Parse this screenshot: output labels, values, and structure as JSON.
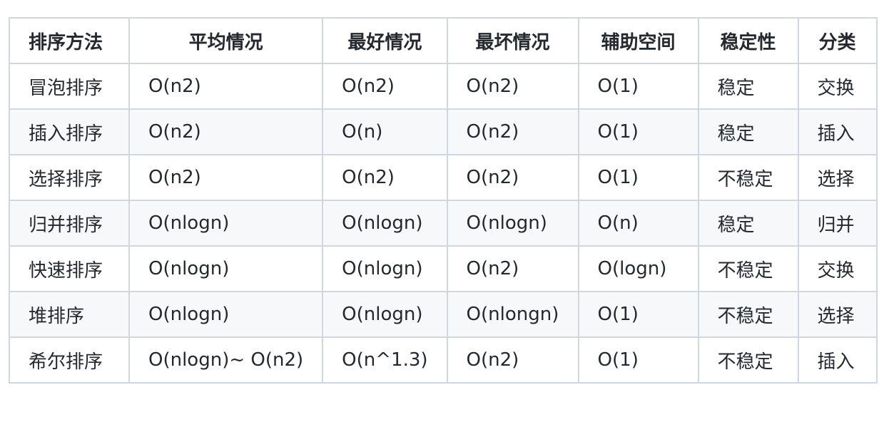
{
  "table": {
    "headers": [
      "排序方法",
      "平均情况",
      "最好情况",
      "最坏情况",
      "辅助空间",
      "稳定性",
      "分类"
    ],
    "rows": [
      [
        "冒泡排序",
        "O(n2)",
        "O(n2)",
        "O(n2)",
        "O(1)",
        "稳定",
        "交换"
      ],
      [
        "插入排序",
        "O(n2)",
        "O(n)",
        "O(n2)",
        "O(1)",
        "稳定",
        "插入"
      ],
      [
        "选择排序",
        "O(n2)",
        "O(n2)",
        "O(n2)",
        "O(1)",
        "不稳定",
        "选择"
      ],
      [
        "归并排序",
        "O(nlogn)",
        "O(nlogn)",
        "O(nlogn)",
        "O(n)",
        "稳定",
        "归并"
      ],
      [
        "快速排序",
        "O(nlogn)",
        "O(nlogn)",
        "O(n2)",
        "O(logn)",
        "不稳定",
        "交换"
      ],
      [
        "堆排序",
        "O(nlogn)",
        "O(nlogn)",
        "O(nlongn)",
        "O(1)",
        "不稳定",
        "选择"
      ],
      [
        "希尔排序",
        "O(nlogn)~ O(n2)",
        "O(n^1.3)",
        "O(n2)",
        "O(1)",
        "不稳定",
        "插入"
      ]
    ]
  }
}
